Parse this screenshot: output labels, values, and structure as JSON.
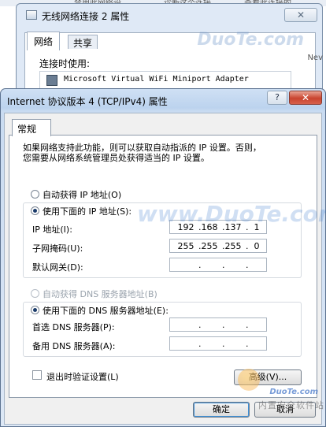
{
  "background": {
    "strip_texts": [
      "禁用此网络设",
      "诊断这个连接",
      "查看此连接的"
    ]
  },
  "back_dialog": {
    "title": "无线网络连接 2 属性",
    "close_glyph": "✕",
    "tabs": [
      "网络",
      "共享"
    ],
    "connect_label": "连接时使用:",
    "adapter_name": "Microsoft Virtual WiFi Miniport Adapter",
    "right_text": "Nev"
  },
  "dialog": {
    "title": "Internet 协议版本 4 (TCP/IPv4) 属性",
    "help_glyph": "?",
    "close_glyph": "✕",
    "tab": "常规",
    "description_line1": "如果网络支持此功能，则可以获取自动指派的 IP 设置。否则，",
    "description_line2": "您需要从网络系统管理员处获得适当的 IP 设置。",
    "ip_section": {
      "auto_label": "自动获得 IP 地址(O)",
      "manual_label": "使用下面的 IP 地址(S):",
      "fields": [
        {
          "label": "IP 地址(I):",
          "octets": [
            "192",
            "168",
            "137",
            "1"
          ]
        },
        {
          "label": "子网掩码(U):",
          "octets": [
            "255",
            "255",
            "255",
            "0"
          ]
        },
        {
          "label": "默认网关(D):",
          "octets": [
            "",
            "",
            "",
            ""
          ]
        }
      ]
    },
    "dns_section": {
      "auto_label": "自动获得 DNS 服务器地址(B)",
      "manual_label": "使用下面的 DNS 服务器地址(E):",
      "fields": [
        {
          "label": "首选 DNS 服务器(P):",
          "octets": [
            "",
            "",
            "",
            ""
          ]
        },
        {
          "label": "备用 DNS 服务器(A):",
          "octets": [
            "",
            "",
            "",
            ""
          ]
        }
      ]
    },
    "validate_label": "退出时验证设置(L)",
    "advanced_button": "高级(V)...",
    "ok_button": "确定",
    "cancel_button": "取消"
  },
  "watermarks": {
    "center": "www.DuoTe.com",
    "corner_brand": "DuoTe.com",
    "corner_cn": "内置安全软件站"
  },
  "colors": {
    "title_bar": "#bcd3ee",
    "close_button": "#c9442f",
    "ok_focus": "#3d8fd6"
  }
}
